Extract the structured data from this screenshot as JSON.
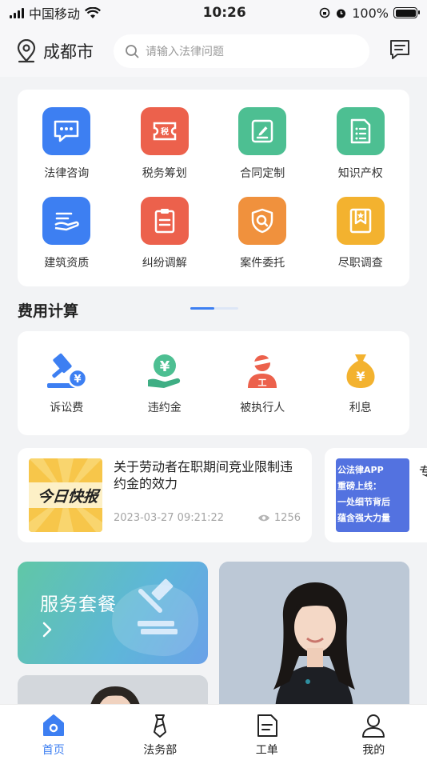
{
  "status_bar": {
    "carrier": "中国移动",
    "time": "10:26",
    "battery": "100%"
  },
  "header": {
    "city": "成都市",
    "search_placeholder": "请输入法律问题"
  },
  "services": [
    {
      "label": "法律咨询",
      "color": "#3d7ff2",
      "icon": "chat-bubble-icon"
    },
    {
      "label": "税务筹划",
      "color": "#ec614c",
      "icon": "tax-ticket-icon"
    },
    {
      "label": "合同定制",
      "color": "#4dbf92",
      "icon": "contract-edit-icon"
    },
    {
      "label": "知识产权",
      "color": "#4dbf92",
      "icon": "document-list-icon"
    },
    {
      "label": "建筑资质",
      "color": "#3d7ff2",
      "icon": "building-hand-icon"
    },
    {
      "label": "纠纷调解",
      "color": "#ec614c",
      "icon": "clipboard-icon"
    },
    {
      "label": "案件委托",
      "color": "#f0913d",
      "icon": "shield-search-icon"
    },
    {
      "label": "尽职调查",
      "color": "#f3b22f",
      "icon": "bookmark-star-icon"
    }
  ],
  "fee_section": {
    "title": "费用计算",
    "items": [
      {
        "label": "诉讼费",
        "icon": "gavel-yuan-icon"
      },
      {
        "label": "违约金",
        "icon": "yuan-hand-icon"
      },
      {
        "label": "被执行人",
        "icon": "person-enforced-icon"
      },
      {
        "label": "利息",
        "icon": "money-bag-icon"
      }
    ]
  },
  "news": [
    {
      "title": "关于劳动者在职期间竞业限制违约金的效力",
      "date": "2023-03-27 09:21:22",
      "views": "1256",
      "thumb_text": "今日快报"
    },
    {
      "thumb_lines": [
        "公法律APP",
        "重磅上线：",
        "一处细节背后",
        "蕴含强大力量"
      ],
      "title_peek": "专"
    }
  ],
  "package": {
    "title": "服务套餐"
  },
  "tabs": [
    {
      "label": "首页",
      "icon": "home-icon",
      "active": true
    },
    {
      "label": "法务部",
      "icon": "tie-icon",
      "active": false
    },
    {
      "label": "工单",
      "icon": "document-icon",
      "active": false
    },
    {
      "label": "我的",
      "icon": "person-icon",
      "active": false
    }
  ]
}
